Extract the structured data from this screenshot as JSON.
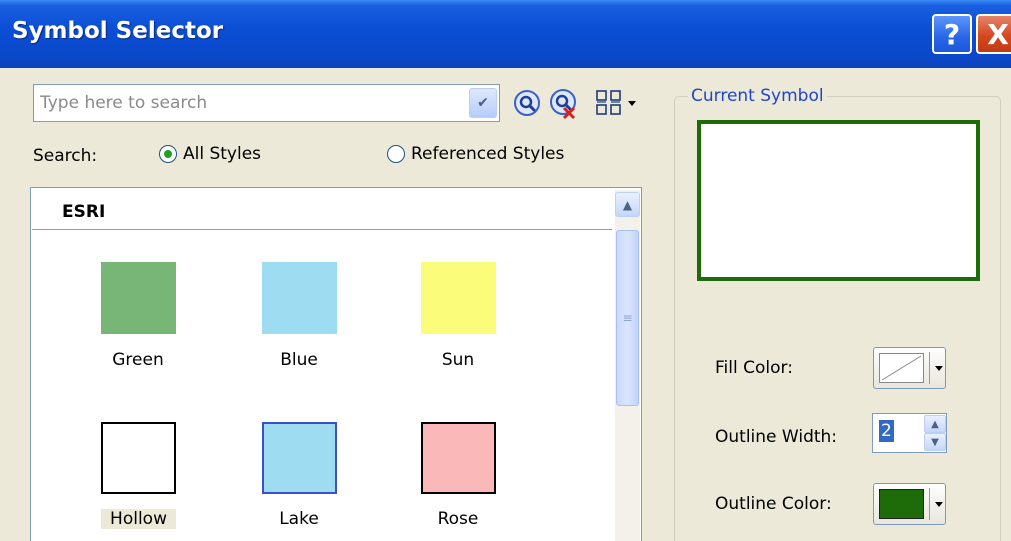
{
  "window": {
    "title": "Symbol Selector",
    "help_label": "?",
    "close_label": "X"
  },
  "search": {
    "placeholder": "Type here to search",
    "value": "",
    "label": "Search:",
    "options": [
      "All Styles",
      "Referenced Styles"
    ],
    "selected": "All Styles"
  },
  "symbols": {
    "group": "ESRI",
    "items": [
      {
        "label": "Green",
        "fill": "#77b677",
        "outline": "none"
      },
      {
        "label": "Blue",
        "fill": "#9edcf1",
        "outline": "none"
      },
      {
        "label": "Sun",
        "fill": "#fbfc7a",
        "outline": "none"
      },
      {
        "label": "Hollow",
        "fill": "#ffffff",
        "outline": "#000000",
        "selected": true
      },
      {
        "label": "Lake",
        "fill": "#9edcf1",
        "outline": "#3c4ec8"
      },
      {
        "label": "Rose",
        "fill": "#fbb8b8",
        "outline": "#000000"
      }
    ]
  },
  "current_symbol": {
    "title": "Current Symbol",
    "fill_color_label": "Fill Color:",
    "outline_width_label": "Outline Width:",
    "outline_width_value": "2",
    "outline_color_label": "Outline Color:",
    "outline_color": "#1e6b0a",
    "fill_color": "none"
  },
  "colors": {
    "titlebar": "#0b4fd6",
    "dialog_bg": "#ece9d8",
    "group_title": "#1f46c8"
  }
}
